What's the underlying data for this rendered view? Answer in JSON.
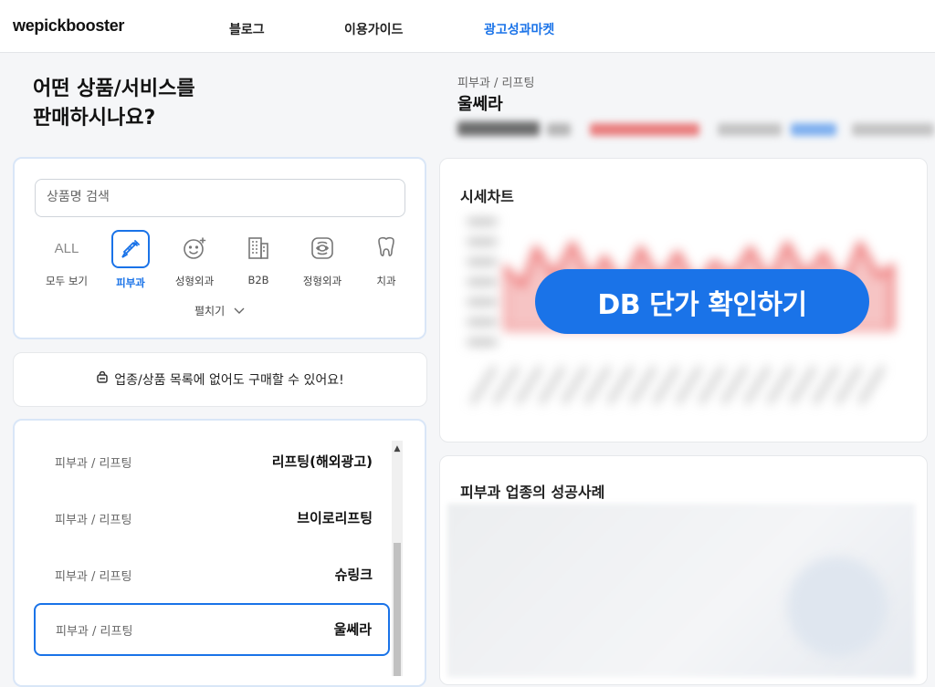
{
  "header": {
    "logo": "wepickbooster",
    "nav": [
      "블로그",
      "이용가이드",
      "광고성과마켓"
    ],
    "active_nav": "광고성과마켓"
  },
  "left": {
    "headline_line1": "어떤 상품/서비스를",
    "headline_line2": "판매하시나요?",
    "search": {
      "placeholder": "상품명 검색",
      "value": ""
    },
    "categories": [
      {
        "icon": "ALL",
        "label": "모두 보기",
        "active": false
      },
      {
        "icon": "syringe-icon",
        "label": "피부과",
        "active": true
      },
      {
        "icon": "face-sparkle-icon",
        "label": "성형외과",
        "active": false
      },
      {
        "icon": "building-icon",
        "label": "B2B",
        "active": false
      },
      {
        "icon": "spine-icon",
        "label": "정형외과",
        "active": false
      },
      {
        "icon": "tooth-icon",
        "label": "치과",
        "active": false
      }
    ],
    "expand_label": "펼치기",
    "notice": "업종/상품 목록에 없어도 구매할 수 있어요!",
    "products": [
      {
        "category": "피부과 / 리프팅",
        "name": "리프팅(해외광고)",
        "selected": false
      },
      {
        "category": "피부과 / 리프팅",
        "name": "브이로리프팅",
        "selected": false
      },
      {
        "category": "피부과 / 리프팅",
        "name": "슈링크",
        "selected": false
      },
      {
        "category": "피부과 / 리프팅",
        "name": "울쎄라",
        "selected": true
      }
    ]
  },
  "right": {
    "breadcrumb": "피부과 / 리프팅",
    "title": "울쎄라",
    "price_chart_title": "시세차트",
    "cta_label": "DB 단가 확인하기",
    "success_title": "피부과 업종의 성공사례"
  },
  "colors": {
    "accent": "#1a73e8",
    "panel_border": "#d9e6f7",
    "background": "#f5f6f8"
  }
}
